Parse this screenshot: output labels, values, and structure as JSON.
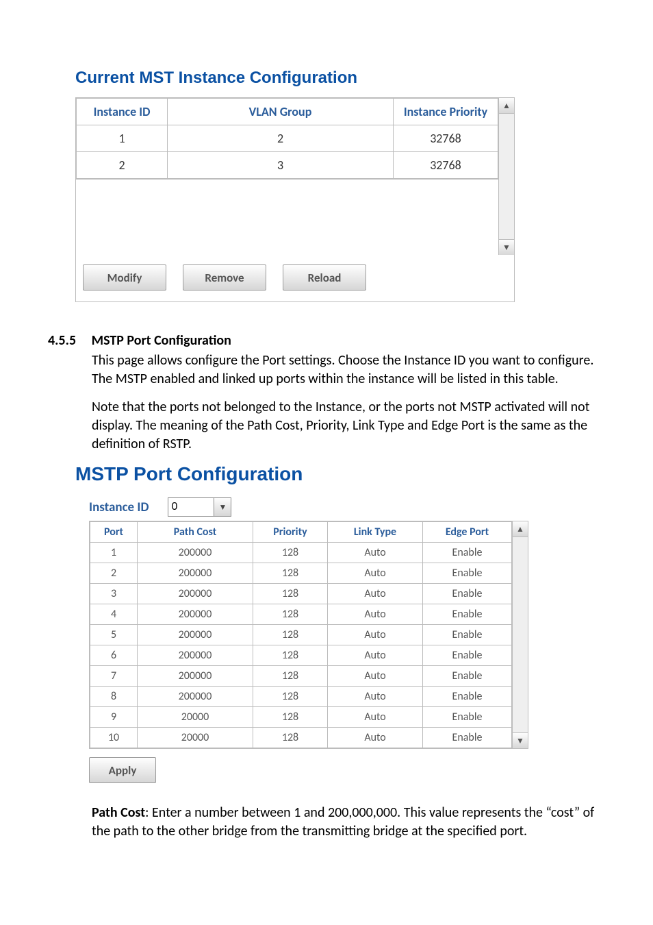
{
  "mst": {
    "title": "Current MST Instance Configuration",
    "headers": {
      "id": "Instance ID",
      "vlan": "VLAN Group",
      "priority": "Instance Priority"
    },
    "rows": [
      {
        "id": "1",
        "vlan": "2",
        "priority": "32768"
      },
      {
        "id": "2",
        "vlan": "3",
        "priority": "32768"
      }
    ],
    "buttons": {
      "modify": "Modify",
      "remove": "Remove",
      "reload": "Reload"
    }
  },
  "sub": {
    "num": "4.5.5",
    "title": "MSTP Port Configuration",
    "p1": "This page allows configure the Port settings. Choose the Instance ID you want to configure. The MSTP enabled and linked up ports within the instance will be listed in this table.",
    "p2": "Note that the ports not belonged to the Instance, or the ports not MSTP activated will not display. The meaning of the Path Cost, Priority, Link Type and Edge Port is the same as the definition of RSTP."
  },
  "mstp": {
    "title": "MSTP Port Configuration",
    "instance_label": "Instance ID",
    "instance_value": "0",
    "headers": {
      "port": "Port",
      "cost": "Path Cost",
      "priority": "Priority",
      "link": "Link Type",
      "edge": "Edge Port"
    },
    "rows": [
      {
        "port": "1",
        "cost": "200000",
        "priority": "128",
        "link": "Auto",
        "edge": "Enable"
      },
      {
        "port": "2",
        "cost": "200000",
        "priority": "128",
        "link": "Auto",
        "edge": "Enable"
      },
      {
        "port": "3",
        "cost": "200000",
        "priority": "128",
        "link": "Auto",
        "edge": "Enable"
      },
      {
        "port": "4",
        "cost": "200000",
        "priority": "128",
        "link": "Auto",
        "edge": "Enable"
      },
      {
        "port": "5",
        "cost": "200000",
        "priority": "128",
        "link": "Auto",
        "edge": "Enable"
      },
      {
        "port": "6",
        "cost": "200000",
        "priority": "128",
        "link": "Auto",
        "edge": "Enable"
      },
      {
        "port": "7",
        "cost": "200000",
        "priority": "128",
        "link": "Auto",
        "edge": "Enable"
      },
      {
        "port": "8",
        "cost": "200000",
        "priority": "128",
        "link": "Auto",
        "edge": "Enable"
      },
      {
        "port": "9",
        "cost": "20000",
        "priority": "128",
        "link": "Auto",
        "edge": "Enable"
      },
      {
        "port": "10",
        "cost": "20000",
        "priority": "128",
        "link": "Auto",
        "edge": "Enable"
      }
    ],
    "apply": "Apply"
  },
  "desc": {
    "label": "Path Cost",
    "text": ": Enter a number between 1 and 200,000,000. This value represents the “cost” of the path to the other bridge from the transmitting bridge at the specified port."
  }
}
